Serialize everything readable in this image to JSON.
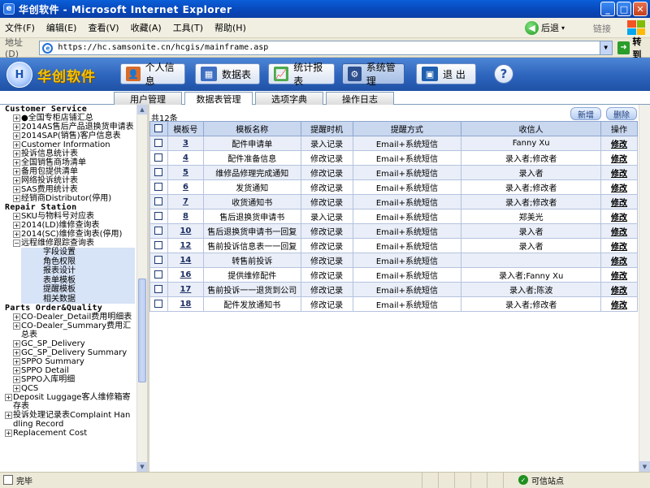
{
  "window": {
    "title": "华创软件 - Microsoft Internet Explorer"
  },
  "menubar": {
    "items": [
      "文件(F)",
      "编辑(E)",
      "查看(V)",
      "收藏(A)",
      "工具(T)",
      "帮助(H)"
    ],
    "back_label": "后退",
    "links_label": "链接"
  },
  "address": {
    "label": "地址(D)",
    "url": "https://hc.samsonite.cn/hcgis/mainframe.asp",
    "go_label": "转到"
  },
  "app": {
    "logo_text": "华创软件",
    "nav": [
      "个人信息",
      "数据表",
      "统计报表",
      "系统管理",
      "退 出"
    ],
    "help": "?"
  },
  "tabs": [
    "用户管理",
    "数据表管理",
    "选项字典",
    "操作日志"
  ],
  "sidebar": {
    "sections": [
      {
        "title": "Customer Service",
        "nodes": [
          "●全国专柜店铺汇总",
          "2014AS售后产品退换货申请表",
          "2014SAP(销售)客户信息表",
          "Customer Information",
          "投诉信息统计表",
          "全国销售商场清单",
          "备用包提供清单",
          "网络投诉统计表",
          "SAS费用统计表",
          "经销商Distributor(停用)"
        ]
      },
      {
        "title": "Repair Station",
        "nodes": [
          "SKU与物料号对应表",
          "2014(LD)维修查询表",
          "2014(SC)维修查询表(停用)"
        ],
        "open_node": "远程维修跟踪查询表",
        "open_children": [
          "字段设置",
          "角色权限",
          "报表设计",
          "表单模板",
          "提醒模板",
          "相关数据"
        ]
      },
      {
        "title": "Parts Order&Quality",
        "nodes": [
          "CO-Dealer_Detail费用明细表",
          "CO-Dealer_Summary费用汇总表",
          "GC_SP_Delivery",
          "GC_SP_Delivery Summary",
          "SPPO Summary",
          "SPPO Detail",
          "SPPO入库明细",
          "QCS"
        ]
      },
      {
        "title": "",
        "nodes": [
          "Deposit Luggage客人维修箱寄存表",
          "投诉处理记录表Complaint Handling Record",
          "Replacement Cost"
        ]
      }
    ]
  },
  "main": {
    "count_label": "共12条",
    "add_label": "新增",
    "delete_label": "删除",
    "columns": [
      "",
      "模板号",
      "模板名称",
      "提醒时机",
      "提醒方式",
      "收信人",
      "操作"
    ],
    "rows": [
      {
        "id": "3",
        "name": "配件申请单",
        "timing": "录入记录",
        "method": "Email+系统短信",
        "recipient": "Fanny Xu",
        "action": "修改"
      },
      {
        "id": "4",
        "name": "配件准备信息",
        "timing": "修改记录",
        "method": "Email+系统短信",
        "recipient": "录入者;修改者",
        "action": "修改"
      },
      {
        "id": "5",
        "name": "维修品修理完成通知",
        "timing": "修改记录",
        "method": "Email+系统短信",
        "recipient": "录入者",
        "action": "修改"
      },
      {
        "id": "6",
        "name": "发货通知",
        "timing": "修改记录",
        "method": "Email+系统短信",
        "recipient": "录入者;修改者",
        "action": "修改"
      },
      {
        "id": "7",
        "name": "收货通知书",
        "timing": "修改记录",
        "method": "Email+系统短信",
        "recipient": "录入者;修改者",
        "action": "修改"
      },
      {
        "id": "8",
        "name": "售后退换货申请书",
        "timing": "录入记录",
        "method": "Email+系统短信",
        "recipient": "郑美光",
        "action": "修改"
      },
      {
        "id": "10",
        "name": "售后退换货申请书一回复",
        "timing": "修改记录",
        "method": "Email+系统短信",
        "recipient": "录入者",
        "action": "修改"
      },
      {
        "id": "12",
        "name": "售前投诉信息表一一回复",
        "timing": "修改记录",
        "method": "Email+系统短信",
        "recipient": "录入者",
        "action": "修改"
      },
      {
        "id": "14",
        "name": "转售前投诉",
        "timing": "修改记录",
        "method": "Email+系统短信",
        "recipient": "",
        "action": "修改"
      },
      {
        "id": "16",
        "name": "提供维修配件",
        "timing": "修改记录",
        "method": "Email+系统短信",
        "recipient": "录入者;Fanny Xu",
        "action": "修改"
      },
      {
        "id": "17",
        "name": "售前投诉一一退货到公司",
        "timing": "修改记录",
        "method": "Email+系统短信",
        "recipient": "录入者;陈波",
        "action": "修改"
      },
      {
        "id": "18",
        "name": "配件发放通知书",
        "timing": "修改记录",
        "method": "Email+系统短信",
        "recipient": "录入者;修改者",
        "action": "修改"
      }
    ]
  },
  "status": {
    "left": "完毕",
    "zone": "可信站点"
  }
}
